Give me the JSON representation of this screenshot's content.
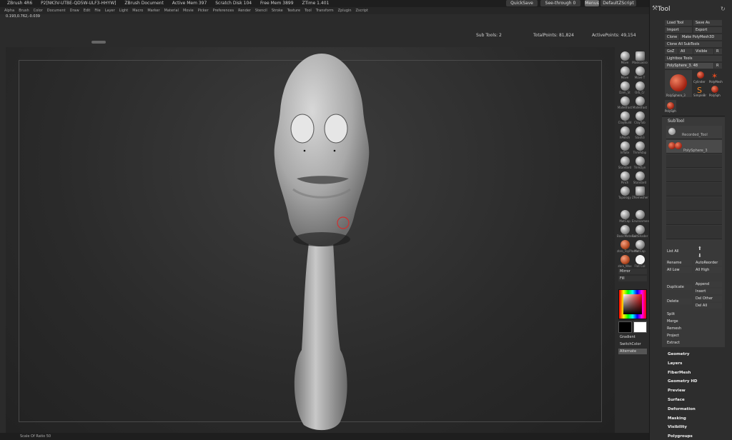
{
  "titlebar": {
    "app": "ZBrush 4R6",
    "session": "P2[NK3V-UTBE-QD5W-ULF3-HHYW]",
    "doc": "ZBrush Document",
    "mem": "Active Mem 397",
    "scratch": "Scratch Disk 104",
    "free": "Free Mem 3899",
    "ztime": "ZTime 1.401"
  },
  "menubar": [
    "Alpha",
    "Brush",
    "Color",
    "Document",
    "Draw",
    "Edit",
    "File",
    "Layer",
    "Light",
    "Macro",
    "Marker",
    "Material",
    "Movie",
    "Picker",
    "Preferences",
    "Render",
    "Stencil",
    "Stroke",
    "Texture",
    "Tool",
    "Transform",
    "Zplugin",
    "Zscript"
  ],
  "coords": "0.193,0.762,-0.039",
  "topbuttons": {
    "quicksave": "QuickSave",
    "seethrough": "See-through",
    "seethrough_val": "0",
    "menus": "Menus",
    "defaultzscript": "DefaultZScript"
  },
  "stats": {
    "subtools": "Sub Tools: 2",
    "totalpoints": "TotalPoints: 81,824",
    "activepoints": "ActivePoints: 49,154"
  },
  "shelf": {
    "items": [
      "Move",
      "MaskLasso",
      "Move",
      "Move T",
      "Dam_St",
      "Orb_Cr",
      "MalletFast",
      "MalletFast",
      "ClayBuild",
      "ClayTub",
      "hPolish",
      "Slash3",
      "Inflate",
      "TrimAdap",
      "Standard",
      "TrimDyn",
      "Pinch",
      "Standard",
      "Topology",
      "ZRemesher",
      "MatCap",
      "Environment",
      "BasicMaterial",
      "FastShader",
      "zbro_ToyPlastic",
      "MatCap",
      "zbro_Wax",
      "Flat Col"
    ],
    "mirror": "Mirror",
    "fill": "Fill",
    "gradient": "Gradient",
    "switchcolor": "SwitchColor",
    "alternate": "Alternate"
  },
  "panel": {
    "title": "Tool",
    "load": "Load Tool",
    "saveas": "Save As",
    "import": "Import",
    "export": "Export",
    "clone": "Clone",
    "make": "Make PolyMesh3D",
    "cloneall": "Clone All SubTools",
    "goz": "GoZ",
    "all": "All",
    "visible": "Visible",
    "r": "R",
    "lightbox": "Lightbox  Tools",
    "polysphere": "PolySphere_3. 48",
    "r2": "R",
    "slots": [
      "PolySphere_3",
      "Cylinder",
      "PolyMesh",
      "SimpleBr",
      "PolySph"
    ],
    "slot_extra": "PolySph",
    "subtool_title": "SubTool",
    "subtool_1": "Recorded_Tool",
    "subtool_2": "PolySphere_3",
    "listall": "List All",
    "rename": "Rename",
    "autoreorder": "AutoReorder",
    "alllow": "All Low",
    "allhigh": "All High",
    "duplicate": "Duplicate",
    "append": "Append",
    "insert": "Insert",
    "delete": "Delete",
    "delother": "Del Other",
    "delall": "Del All",
    "split": "Split",
    "merge": "Merge",
    "remesh": "Remesh",
    "project": "Project",
    "extract": "Extract",
    "sections": [
      "Geometry",
      "Layers",
      "FiberMesh",
      "Geometry HD",
      "Preview",
      "Surface",
      "Deformation",
      "Masking",
      "Visibility",
      "Polygroups"
    ]
  },
  "bottombar": "Scale Of Ratio 50"
}
